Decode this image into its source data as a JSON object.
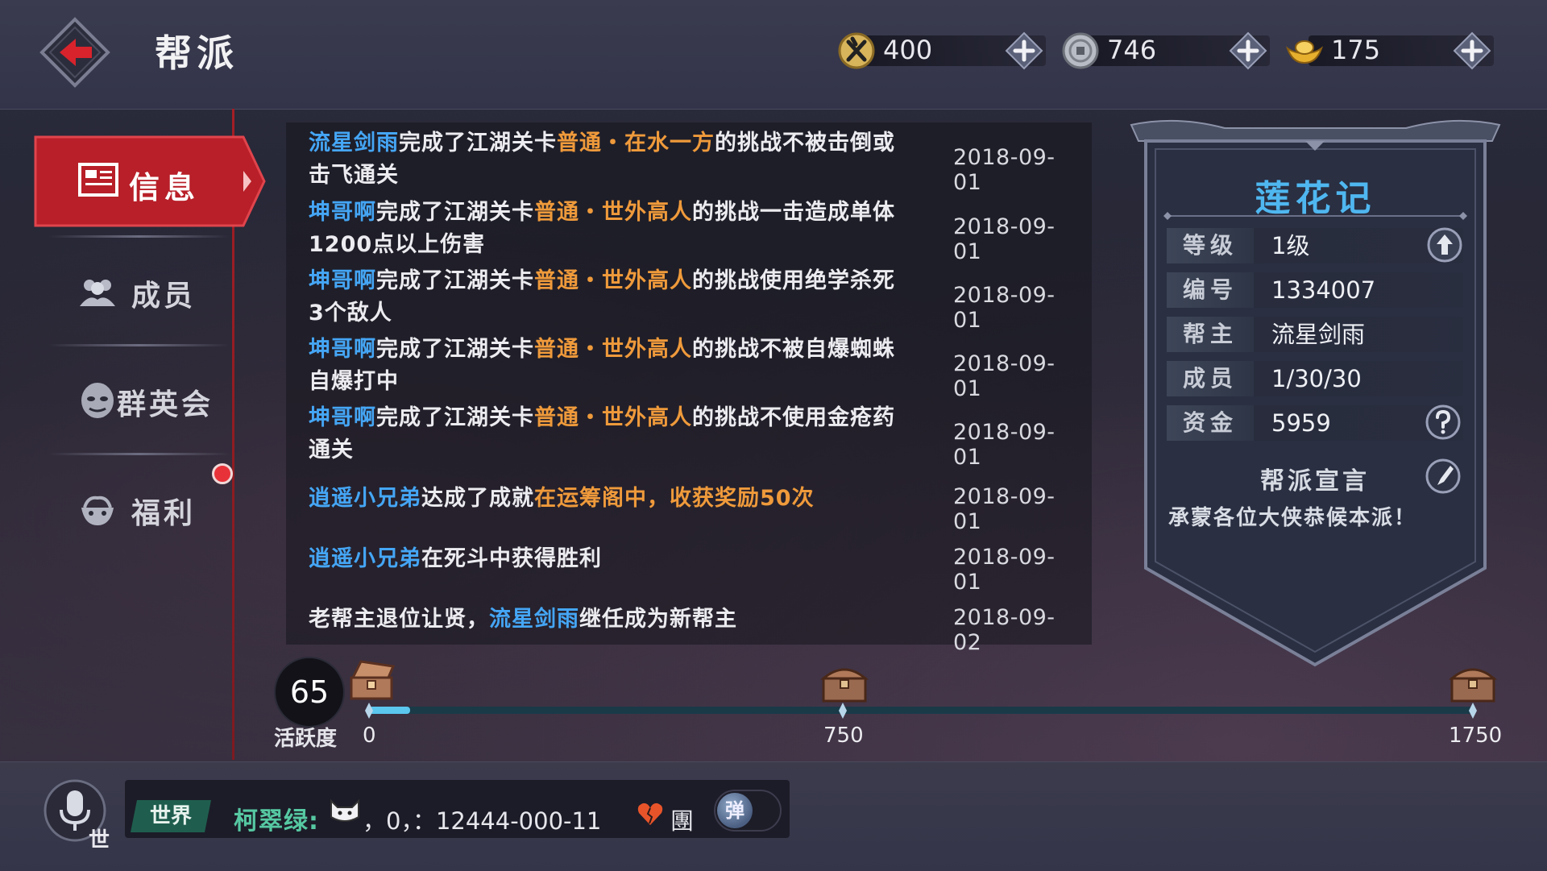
{
  "header": {
    "title": "帮派",
    "currencies": [
      {
        "icon": "yi-coin-icon",
        "amount": "400"
      },
      {
        "icon": "silver-coin-icon",
        "amount": "746"
      },
      {
        "icon": "gold-ingot-icon",
        "amount": "175"
      }
    ]
  },
  "nav": {
    "items": [
      {
        "label": "信息",
        "icon": "notice-board-icon",
        "active": true
      },
      {
        "label": "成员",
        "icon": "members-icon",
        "active": false
      },
      {
        "label": "群英会",
        "icon": "heroes-mask-icon",
        "active": false
      },
      {
        "label": "福利",
        "icon": "welfare-gift-icon",
        "active": false
      }
    ]
  },
  "feed": [
    {
      "parts": [
        {
          "t": "流星剑雨",
          "c": "blue"
        },
        {
          "t": "完成了江湖关卡",
          "c": "white"
        },
        {
          "t": "普通・在水一方",
          "c": "orange"
        },
        {
          "t": "的挑战不被击倒或击飞通关",
          "c": "white"
        }
      ],
      "date": "2018-09-01"
    },
    {
      "parts": [
        {
          "t": "坤哥啊",
          "c": "blue"
        },
        {
          "t": "完成了江湖关卡",
          "c": "white"
        },
        {
          "t": "普通・世外高人",
          "c": "orange"
        },
        {
          "t": "的挑战一击造成单体1200点以上伤害",
          "c": "white"
        }
      ],
      "date": "2018-09-01"
    },
    {
      "parts": [
        {
          "t": "坤哥啊",
          "c": "blue"
        },
        {
          "t": "完成了江湖关卡",
          "c": "white"
        },
        {
          "t": "普通・世外高人",
          "c": "orange"
        },
        {
          "t": "的挑战使用绝学杀死3个敌人",
          "c": "white"
        }
      ],
      "date": "2018-09-01"
    },
    {
      "parts": [
        {
          "t": "坤哥啊",
          "c": "blue"
        },
        {
          "t": "完成了江湖关卡",
          "c": "white"
        },
        {
          "t": "普通・世外高人",
          "c": "orange"
        },
        {
          "t": "的挑战不被自爆蜘蛛自爆打中",
          "c": "white"
        }
      ],
      "date": "2018-09-01"
    },
    {
      "parts": [
        {
          "t": "坤哥啊",
          "c": "blue"
        },
        {
          "t": "完成了江湖关卡",
          "c": "white"
        },
        {
          "t": "普通・世外高人",
          "c": "orange"
        },
        {
          "t": "的挑战不使用金疮药通关",
          "c": "white"
        }
      ],
      "date": "2018-09-01"
    },
    {
      "parts": [
        {
          "t": "逍遥小兄弟",
          "c": "blue"
        },
        {
          "t": "达成了成就",
          "c": "white"
        },
        {
          "t": "在运筹阁中，收获奖励50次",
          "c": "orange"
        }
      ],
      "date": "2018-09-01"
    },
    {
      "parts": [
        {
          "t": "逍遥小兄弟",
          "c": "blue"
        },
        {
          "t": "在死斗中获得胜利",
          "c": "white"
        }
      ],
      "date": "2018-09-01"
    },
    {
      "parts": [
        {
          "t": "老帮主退位让贤，",
          "c": "white"
        },
        {
          "t": "流星剑雨",
          "c": "blue"
        },
        {
          "t": "继任成为新帮主",
          "c": "white"
        }
      ],
      "date": "2018-09-02"
    }
  ],
  "activity": {
    "value": "65",
    "label": "活跃度",
    "current": 65,
    "max": 1750,
    "milestones": [
      "0",
      "750",
      "1750"
    ],
    "chest_icons": [
      "open-chest-icon",
      "chest-icon",
      "chest-icon"
    ]
  },
  "guild": {
    "name": "莲花记",
    "rows": [
      {
        "key": "等级",
        "value": "1级"
      },
      {
        "key": "编号",
        "value": "1334007"
      },
      {
        "key": "帮主",
        "value": "流星剑雨"
      },
      {
        "key": "成员",
        "value": "1/30/30"
      },
      {
        "key": "资金",
        "value": "5959"
      }
    ],
    "manifesto_title": "帮派宣言",
    "manifesto": "承蒙各位大侠恭候本派！"
  },
  "chat": {
    "mic_sub": "世",
    "channel": "世界",
    "sender": "柯翠绿:",
    "message": "，0，：12444-000-11",
    "end": "團",
    "toggle_label": "弹"
  },
  "colors": {
    "accent_red": "#c8222b",
    "name_blue": "#45a6f5",
    "highlight_orange": "#ef9a3b",
    "guild_name_blue": "#4fb7f0",
    "progress_fill": "#5bc6ee",
    "chat_name_green": "#56c8a2"
  }
}
